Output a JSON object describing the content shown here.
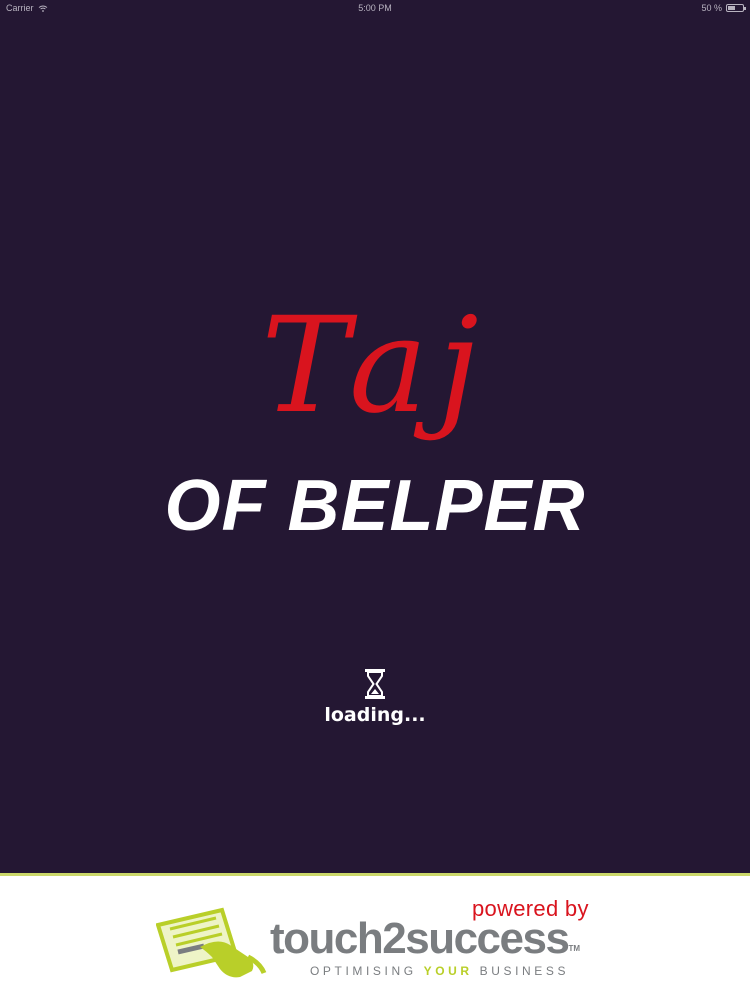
{
  "status_bar": {
    "carrier": "Carrier",
    "time": "5:00 PM",
    "battery": "50 %",
    "battery_level": 0.5
  },
  "splash": {
    "logo_title": "Taj",
    "logo_subtitle": "OF BELPER",
    "loading_text": "loading..."
  },
  "footer": {
    "powered_by": "powered by",
    "brand_name": "touch2success",
    "brand_tm": "TM",
    "tagline_start": "OPTIMISING ",
    "tagline_accent": "YOUR",
    "tagline_end": " BUSINESS"
  },
  "colors": {
    "background": "#241733",
    "logo_red": "#d9141e",
    "brand_gray": "#7a7d80",
    "brand_green": "#b9cf29"
  },
  "icons": {
    "wifi": "wifi-icon",
    "battery": "battery-icon",
    "loading": "hourglass-icon",
    "brand": "touch-card-hand-icon"
  }
}
